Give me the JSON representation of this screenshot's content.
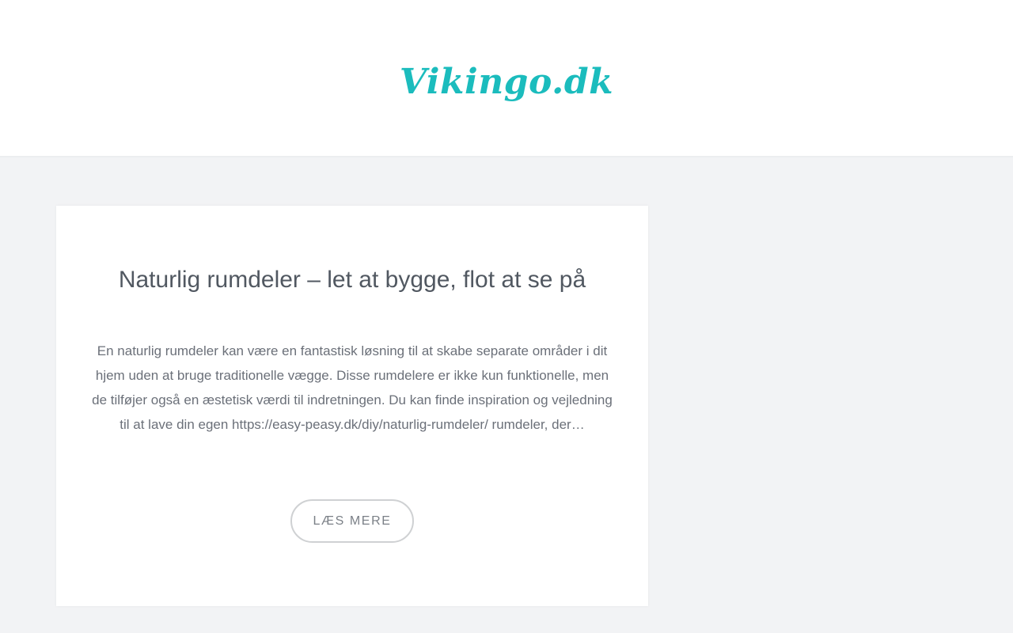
{
  "header": {
    "logo_text": "Vikingo.dk"
  },
  "post": {
    "title": "Naturlig rumdeler – let at bygge, flot at se på",
    "excerpt": "En naturlig rumdeler kan være en fantastisk løsning til at skabe separate områder i dit hjem uden at bruge traditionelle vægge. Disse rumdelere er ikke kun funktionelle, men de tilføjer også en æstetisk værdi til indretningen. Du kan finde inspiration og vejledning til at lave din egen https://easy-peasy.dk/diy/naturlig-rumdeler/ rumdeler, der…",
    "read_more_label": "LÆS MERE"
  },
  "colors": {
    "brand": "#1bbcbd",
    "page_background": "#f2f3f5",
    "title_text": "#515861",
    "body_text": "#6b7079"
  }
}
